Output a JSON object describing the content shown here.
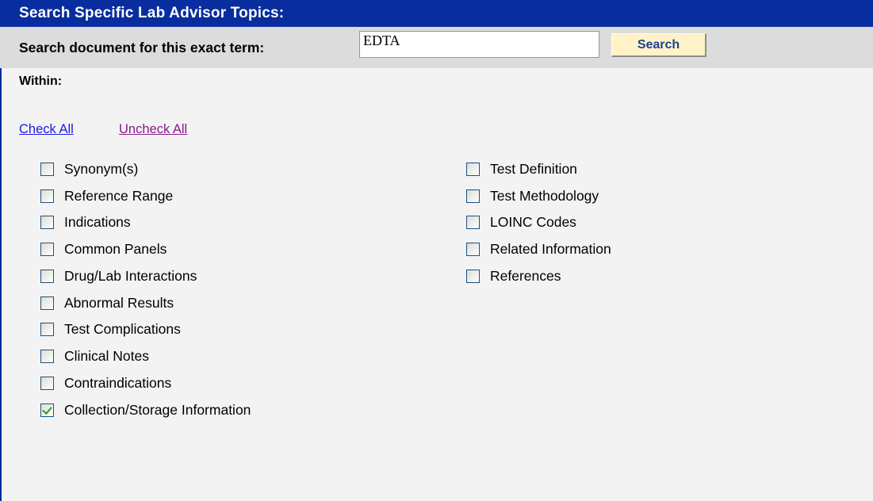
{
  "header": {
    "title": "Search Specific Lab Advisor Topics:"
  },
  "search": {
    "label": "Search document for this exact term:",
    "value": "EDTA",
    "button_label": "Search"
  },
  "within": {
    "label": "Within:",
    "check_all": "Check All",
    "uncheck_all": "Uncheck All"
  },
  "options": {
    "left": [
      {
        "label": "Synonym(s)",
        "checked": false
      },
      {
        "label": "Reference Range",
        "checked": false
      },
      {
        "label": "Indications",
        "checked": false
      },
      {
        "label": "Common Panels",
        "checked": false
      },
      {
        "label": "Drug/Lab Interactions",
        "checked": false
      },
      {
        "label": "Abnormal Results",
        "checked": false
      },
      {
        "label": "Test Complications",
        "checked": false
      },
      {
        "label": "Clinical Notes",
        "checked": false
      },
      {
        "label": "Contraindications",
        "checked": false
      },
      {
        "label": "Collection/Storage Information",
        "checked": true
      }
    ],
    "right": [
      {
        "label": "Test Definition",
        "checked": false
      },
      {
        "label": "Test Methodology",
        "checked": false
      },
      {
        "label": "LOINC Codes",
        "checked": false
      },
      {
        "label": "Related Information",
        "checked": false
      },
      {
        "label": "References",
        "checked": false
      }
    ]
  },
  "colors": {
    "title_bar": "#072d9e",
    "search_row": "#dcdcdc",
    "panel": "#f3f3f3",
    "button_bg": "#fff3c7",
    "check_mark": "#21a121",
    "link_unvisited": "#1a1ae6",
    "link_visited": "#8b1a8b"
  }
}
